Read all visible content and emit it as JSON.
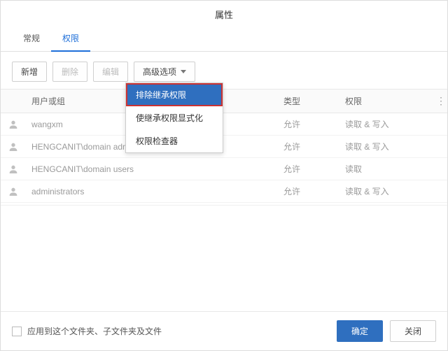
{
  "title": "属性",
  "tabs": {
    "general": "常规",
    "permissions": "权限",
    "active": 1
  },
  "toolbar": {
    "add": "新增",
    "delete": "删除",
    "edit": "编辑",
    "advanced": "高级选项"
  },
  "advanced_menu": {
    "items": [
      {
        "label": "排除继承权限",
        "highlight": true
      },
      {
        "label": "使继承权限显式化"
      },
      {
        "label": "权限检查器"
      }
    ]
  },
  "columns": {
    "user": "用户或组",
    "type": "类型",
    "perm": "权限"
  },
  "rows": [
    {
      "name": "wangxm",
      "type": "允许",
      "perm": "读取 & 写入"
    },
    {
      "name": "HENGCANIT\\domain admins",
      "type": "允许",
      "perm": "读取 & 写入"
    },
    {
      "name": "HENGCANIT\\domain users",
      "type": "允许",
      "perm": "读取"
    },
    {
      "name": "administrators",
      "type": "允许",
      "perm": "读取 & 写入"
    }
  ],
  "footer": {
    "apply_to_children": "应用到这个文件夹、子文件夹及文件",
    "ok": "确定",
    "close": "关闭"
  }
}
